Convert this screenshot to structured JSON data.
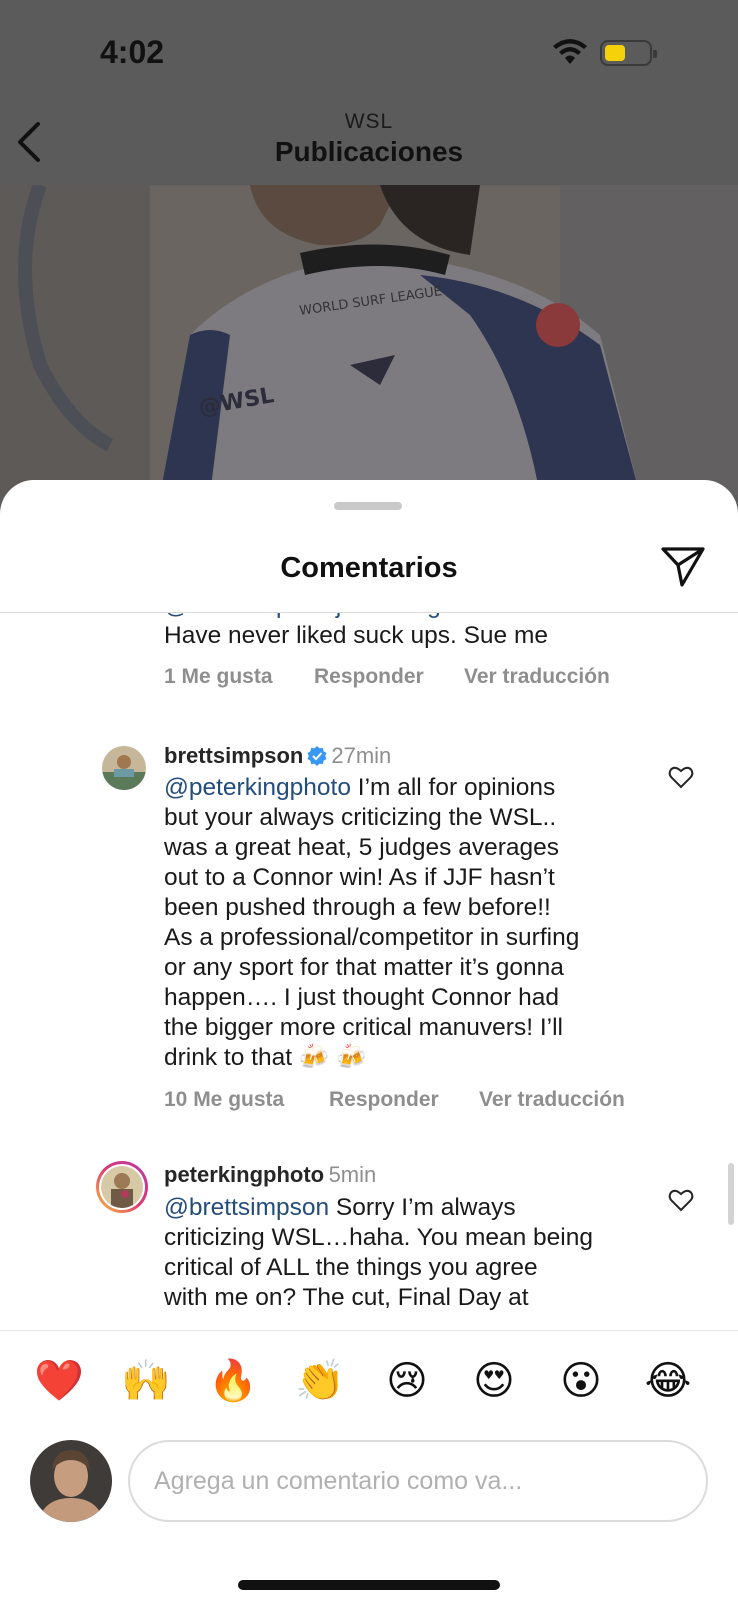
{
  "status_bar": {
    "time": "4:02",
    "wifi_icon": "wifi-icon",
    "battery_icon": "battery-icon",
    "battery_color": "#f5d10a"
  },
  "nav": {
    "subtitle": "WSL",
    "title": "Publicaciones",
    "back_icon": "chevron-left-icon"
  },
  "sheet": {
    "title": "Comentarios",
    "share_icon": "paper-plane-icon"
  },
  "comments": [
    {
      "partial": true,
      "text_line": "Have never liked suck ups. Sue me",
      "cut_line": "@brettsimpson just being honest.",
      "likes": "1 Me gusta",
      "reply": "Responder",
      "translate": "Ver traducción"
    },
    {
      "username": "brettsimpson",
      "verified": true,
      "time": "27min",
      "mention": "@peterkingphoto",
      "lines": [
        " I’m all for opinions",
        "but your always criticizing the WSL..",
        "was a great heat, 5 judges averages",
        "out to a Connor win! As if JJF hasn’t",
        "been pushed through a few before!!",
        "As a professional/competitor in surfing",
        "or any sport for that matter  it’s gonna",
        "happen…. I just thought Connor had",
        "the bigger more critical manuvers! I’ll",
        "drink to that 🍻 🍻"
      ],
      "likes": "10 Me gusta",
      "reply": "Responder",
      "translate": "Ver traducción",
      "heart_icon": "heart-outline-icon"
    },
    {
      "username": "peterkingphoto",
      "verified": false,
      "time": "5min",
      "mention": "@brettsimpson",
      "lines": [
        " Sorry I’m always",
        "criticizing WSL…haha. You mean being",
        "critical of ALL the things you agree",
        "with me on? The cut, Final Day at"
      ],
      "heart_icon": "heart-outline-icon"
    }
  ],
  "emojis": [
    "❤️",
    "🙌",
    "🔥",
    "👏",
    "😢",
    "😍",
    "😮",
    "😂"
  ],
  "input": {
    "placeholder": "Agrega un comentario como va..."
  },
  "colors": {
    "accent_mention": "#234d7c",
    "verified": "#3897f0",
    "muted": "#8e8e8e"
  }
}
